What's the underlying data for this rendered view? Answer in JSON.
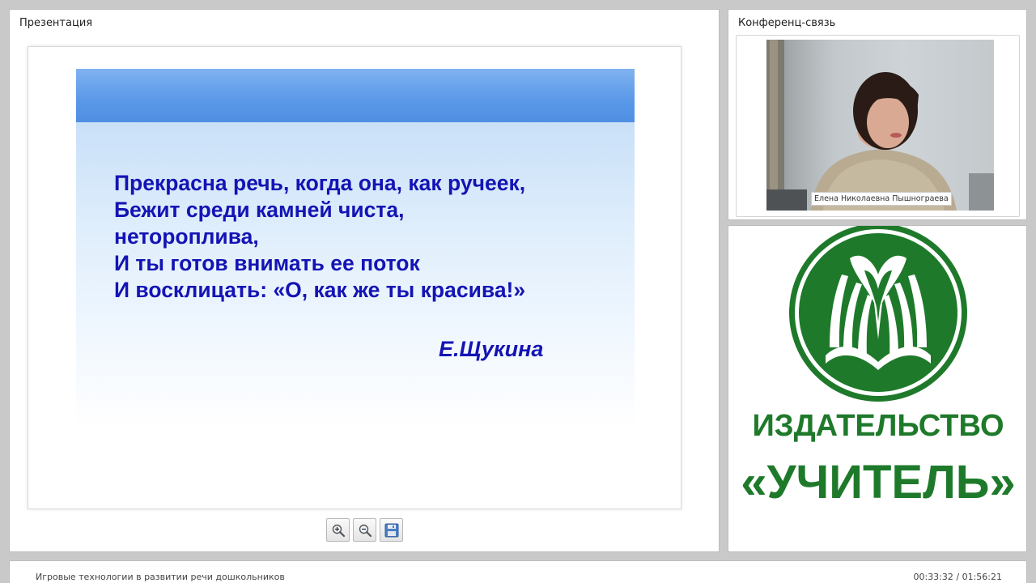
{
  "presentation": {
    "title": "Презентация",
    "slide": {
      "poem_lines": [
        "Прекрасна речь, когда она, как ручеек,",
        "Бежит среди камней чиста,",
        "нетороплива,",
        "И ты готов внимать ее поток",
        "И восклицать: «О, как же ты красива!»"
      ],
      "author": "Е.Щукина"
    },
    "toolbar": {
      "zoom_in_icon": "zoom-in-icon",
      "zoom_out_icon": "zoom-out-icon",
      "save_icon": "floppy-disk-icon"
    }
  },
  "conference": {
    "title": "Конференц-связь",
    "participant_name": "Елена Николаевна Пышнограева"
  },
  "logo": {
    "line1": "ИЗДАТЕЛЬСТВО",
    "line2": "«УЧИТЕЛЬ»",
    "color": "#1e7a2a"
  },
  "bottom_bar": {
    "course_title": "Игровые технологии в развитии речи дошкольников",
    "time": "00:33:32 / 01:56:21"
  },
  "colors": {
    "poem_text": "#1414b4",
    "slide_band": "#5a98e8"
  }
}
